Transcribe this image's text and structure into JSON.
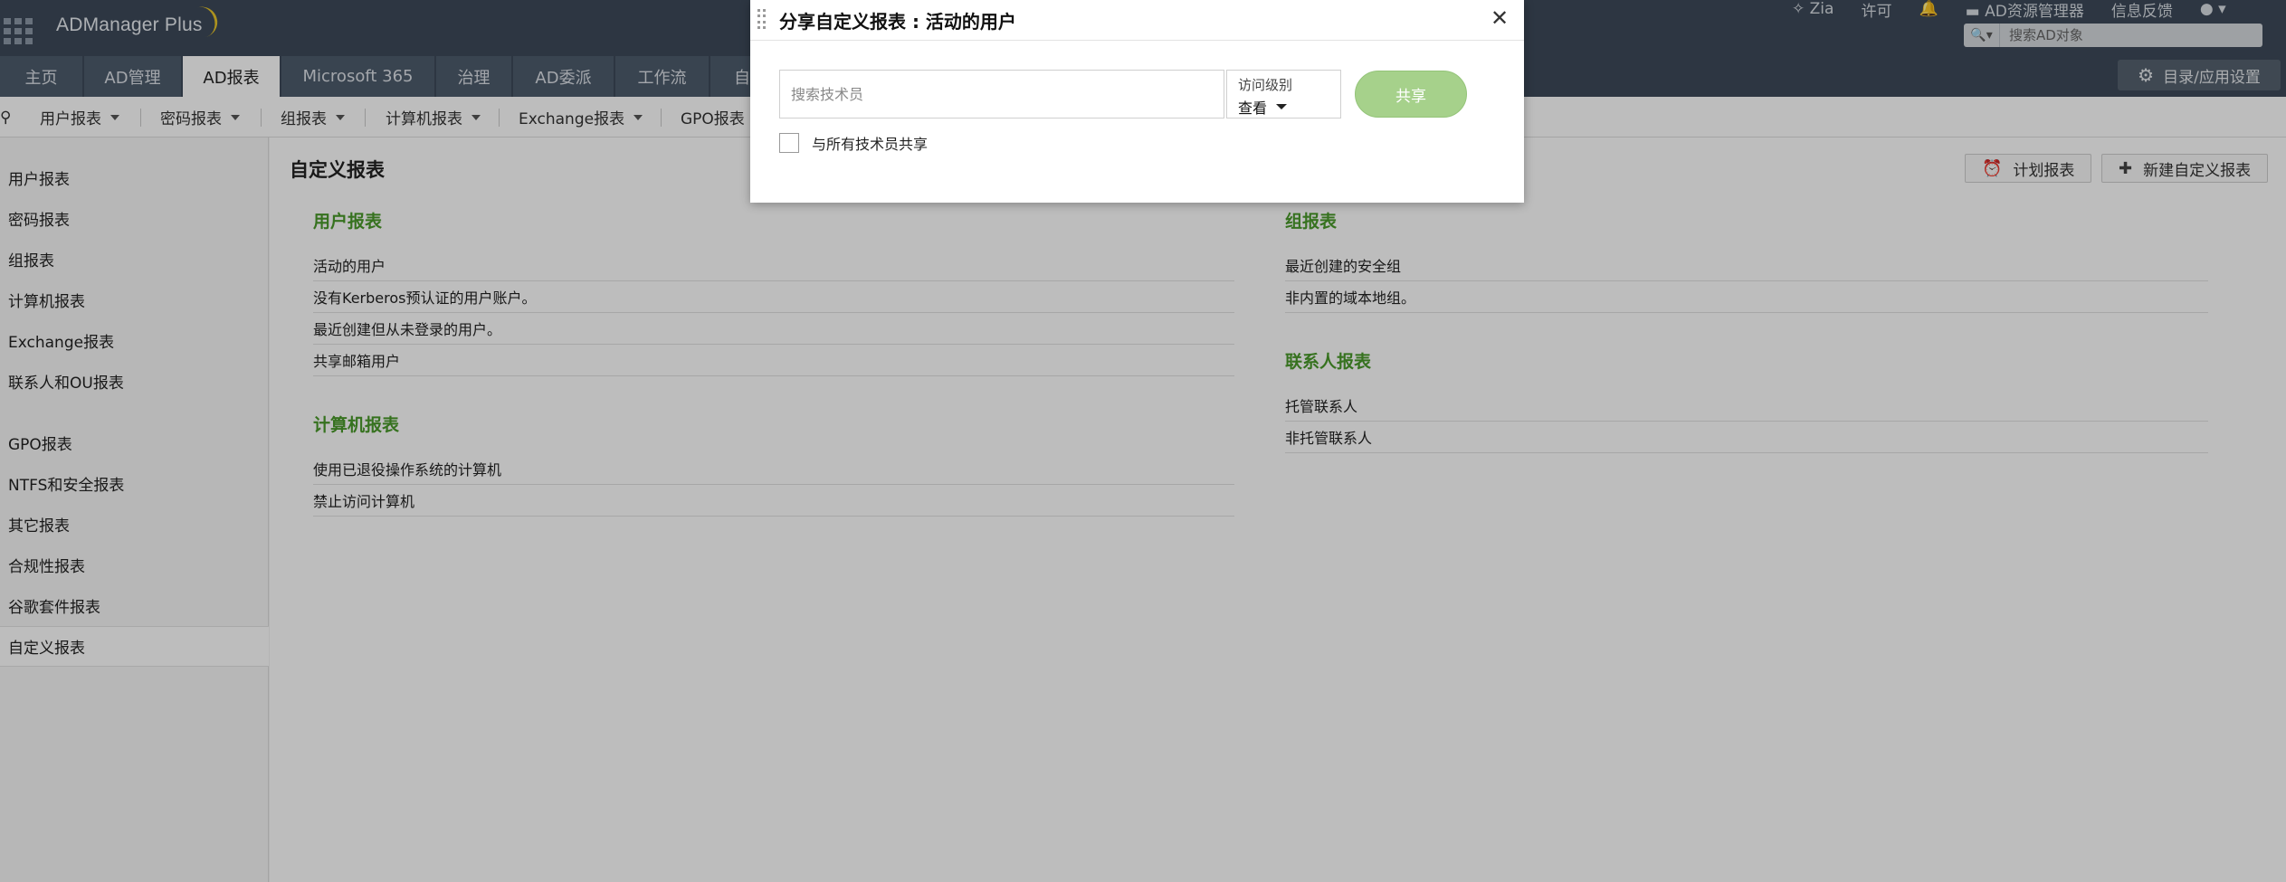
{
  "header": {
    "app_title": "ADManager Plus",
    "zia": "Zia",
    "license": "许可",
    "ad_explorer": "AD资源管理器",
    "feedback": "信息反馈",
    "search_placeholder": "搜索AD对象"
  },
  "tabs": [
    {
      "label": "主页"
    },
    {
      "label": "AD管理"
    },
    {
      "label": "AD报表",
      "active": true
    },
    {
      "label": "Microsoft 365"
    },
    {
      "label": "治理"
    },
    {
      "label": "AD委派"
    },
    {
      "label": "工作流"
    },
    {
      "label": "自"
    }
  ],
  "settings_label": "目录/应用设置",
  "subnav": [
    "用户报表",
    "密码报表",
    "组报表",
    "计算机报表",
    "Exchange报表",
    "GPO报表"
  ],
  "sidebar": {
    "items": [
      "用户报表",
      "密码报表",
      "组报表",
      "计算机报表",
      "Exchange报表",
      "联系人和OU报表",
      "GPO报表",
      "NTFS和安全报表",
      "其它报表",
      "合规性报表",
      "谷歌套件报表",
      "自定义报表"
    ],
    "active_index": 11
  },
  "content": {
    "title": "自定义报表",
    "schedule_label": "计划报表",
    "new_label": "新建自定义报表",
    "sections": [
      {
        "title": "用户报表",
        "items": [
          "活动的用户",
          "没有Kerberos预认证的用户账户。",
          "最近创建但从未登录的用户。",
          "共享邮箱用户"
        ]
      },
      {
        "title": "计算机报表",
        "items": [
          "使用已退役操作系统的计算机",
          "禁止访问计算机"
        ]
      },
      {
        "title": "组报表",
        "items": [
          "最近创建的安全组",
          "非内置的域本地组。"
        ]
      },
      {
        "title": "联系人报表",
        "items": [
          "托管联系人",
          "非托管联系人"
        ]
      }
    ]
  },
  "dialog": {
    "title": "分享自定义报表 : 活动的用户",
    "tech_placeholder": "搜索技术员",
    "access_label": "访问级别",
    "access_value": "查看",
    "share_label": "共享",
    "share_all_label": "与所有技术员共享",
    "share_all_checked": false
  },
  "colors": {
    "header_bg": "#3d4a5a",
    "section_title": "#4a9a2a",
    "share_button": "#a6d18b"
  }
}
